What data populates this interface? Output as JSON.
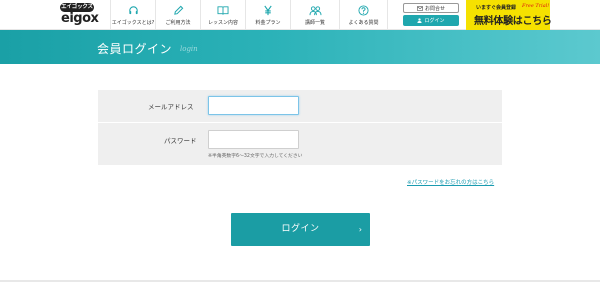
{
  "header": {
    "logo_badge": "エイゴックス",
    "logo_text": "eigox",
    "nav": [
      {
        "label": "エイゴックスとは?",
        "icon": "headset-icon"
      },
      {
        "label": "ご利用方法",
        "icon": "pencil-icon"
      },
      {
        "label": "レッスン内容",
        "icon": "book-icon"
      },
      {
        "label": "料金プラン",
        "icon": "yen-icon"
      },
      {
        "label": "講師一覧",
        "icon": "teachers-icon"
      },
      {
        "label": "よくある質問",
        "icon": "question-icon"
      }
    ],
    "contact_label": "お問合せ",
    "login_label": "ログイン",
    "trial_top": "いますぐ会員登録",
    "trial_free": "Free Trial!",
    "trial_main": "無料体験はこちら"
  },
  "banner": {
    "title": "会員ログイン",
    "subtitle": "login"
  },
  "form": {
    "email_label": "メールアドレス",
    "email_value": "",
    "password_label": "パスワード",
    "password_value": "",
    "password_hint": "※半角英数字6〜32文字で入力してください",
    "forgot_link": "※パスワードをお忘れの方はこちら",
    "submit_label": "ログイン",
    "submit_chevron": "›"
  },
  "colors": {
    "accent": "#1b9da4",
    "trial": "#f5e100",
    "form_bg": "#efefef"
  }
}
